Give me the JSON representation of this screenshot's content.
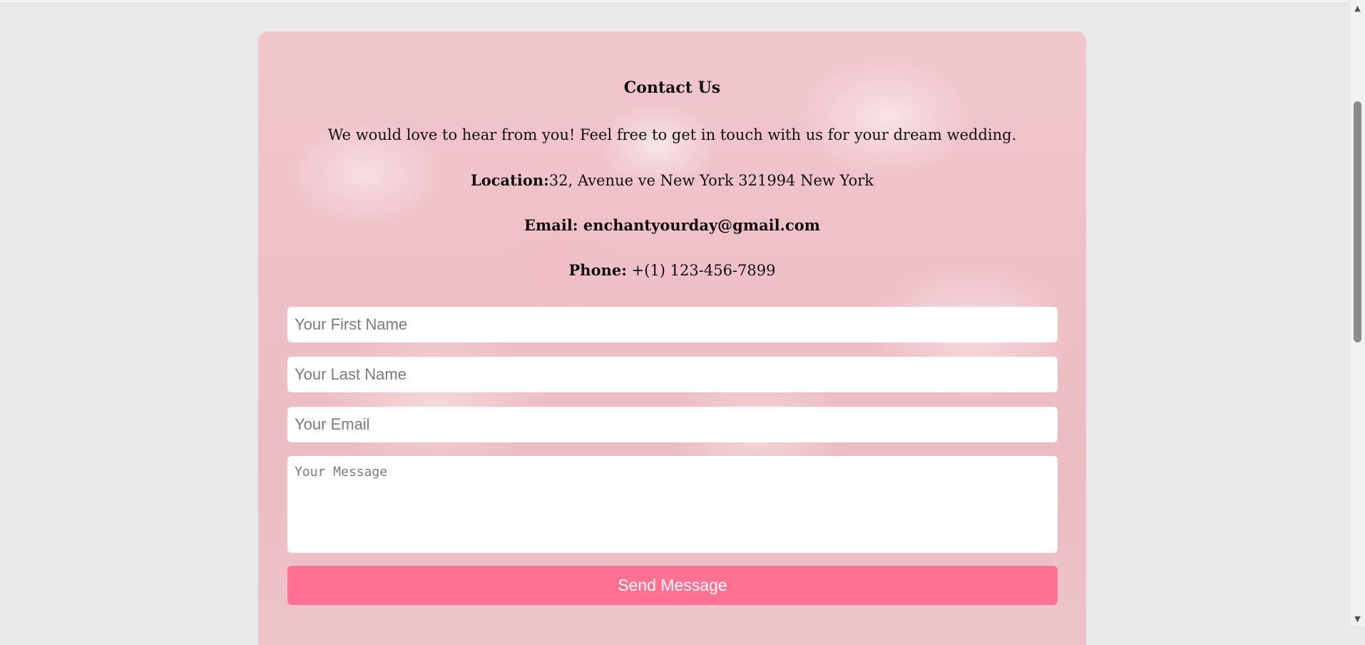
{
  "contact": {
    "title": "Contact Us",
    "intro": "We would love to hear from you! Feel free to get in touch with us for your dream wedding.",
    "location_label": "Location:",
    "location_value": "32, Avenue ve New York 321994 New York",
    "email_label": "Email:",
    "email_value": "enchantyourday@gmail.com",
    "phone_label": "Phone:",
    "phone_value": "+(1) 123-456-7899"
  },
  "form": {
    "first_name_placeholder": "Your First Name",
    "last_name_placeholder": "Your Last Name",
    "email_placeholder": "Your Email",
    "message_placeholder": "Your Message",
    "submit_label": "Send Message"
  },
  "scrollbar": {
    "up_icon": "arrow-up-icon",
    "down_icon": "arrow-down-icon"
  },
  "colors": {
    "page_background": "#e9e9e9",
    "card_tint": "#efc0c7",
    "button": "#ff7193",
    "button_text": "#ffffff"
  }
}
